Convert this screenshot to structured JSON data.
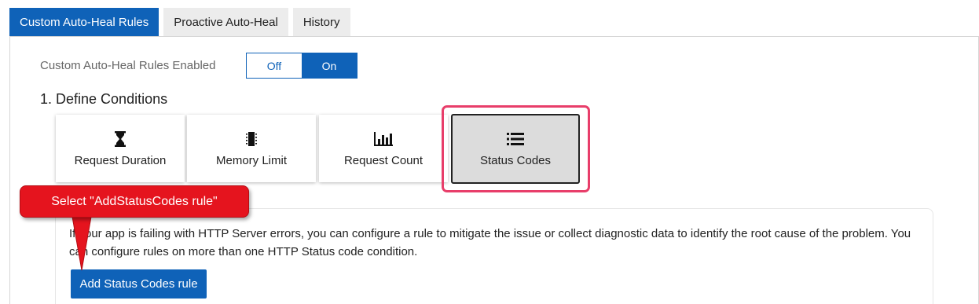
{
  "tabs": [
    {
      "label": "Custom Auto-Heal Rules",
      "active": true
    },
    {
      "label": "Proactive Auto-Heal",
      "active": false
    },
    {
      "label": "History",
      "active": false
    }
  ],
  "enabled": {
    "label": "Custom Auto-Heal Rules Enabled",
    "off_label": "Off",
    "on_label": "On",
    "value": "On"
  },
  "conditions": {
    "title": "1. Define Conditions",
    "cards": [
      {
        "label": "Request Duration",
        "icon": "hourglass-icon"
      },
      {
        "label": "Memory Limit",
        "icon": "memory-chip-icon"
      },
      {
        "label": "Request Count",
        "icon": "bar-chart-icon"
      },
      {
        "label": "Status Codes",
        "icon": "list-icon",
        "selected": true
      }
    ]
  },
  "info": {
    "text": "If your app is failing with HTTP Server errors, you can configure a rule to mitigate the issue or collect diagnostic data to identify the root cause of the problem. You can configure rules on more than one HTTP Status code condition.",
    "button_label": "Add Status Codes rule"
  },
  "annotation": {
    "callout_text": "Select \"AddStatusCodes rule\""
  },
  "colors": {
    "accent": "#0f62b8",
    "highlight": "#e83e6a",
    "callout": "#e5141e"
  }
}
